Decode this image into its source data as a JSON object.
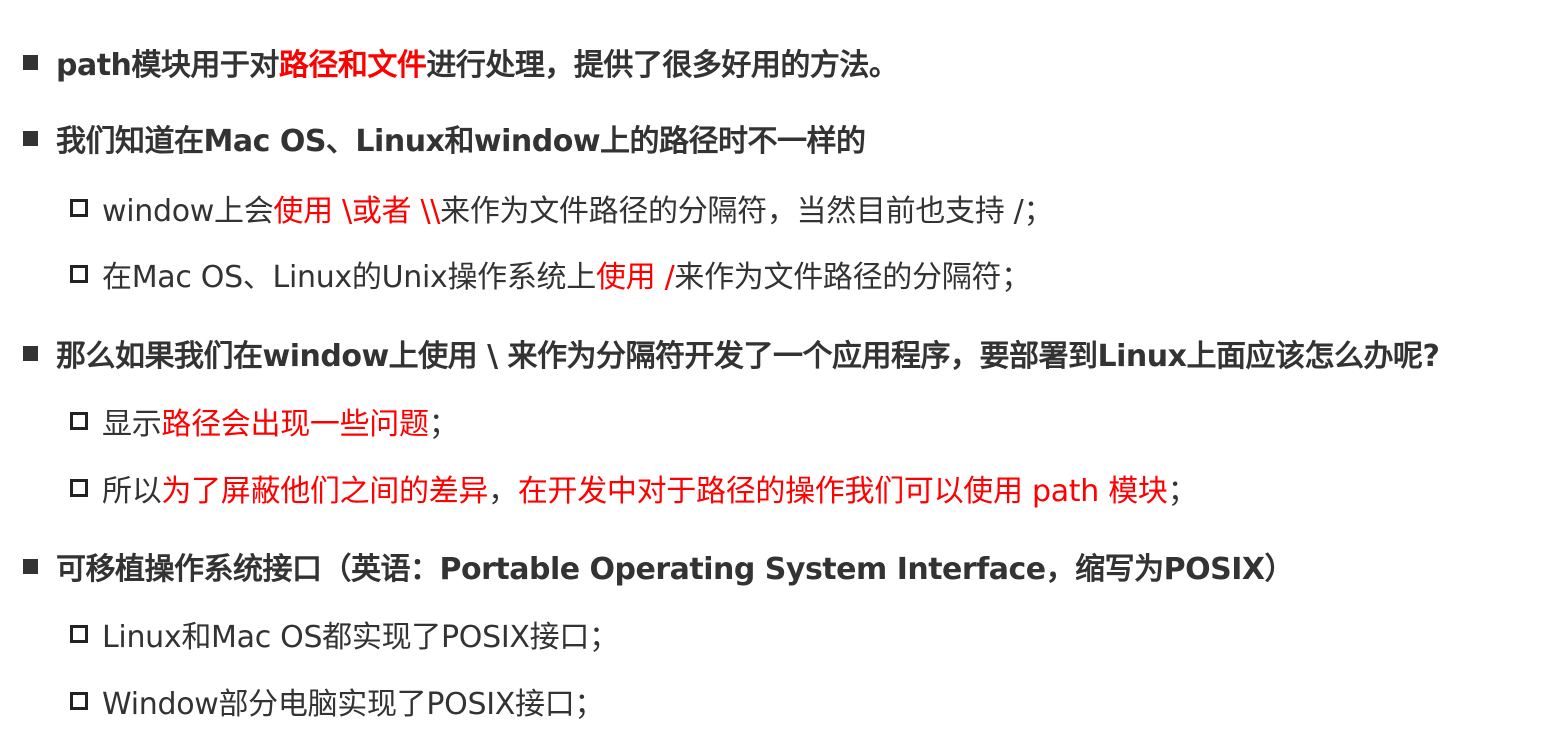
{
  "colors": {
    "text": "#333333",
    "highlight": "#ff0000"
  },
  "items": [
    {
      "level": 1,
      "segments": [
        {
          "text": "path模块用于对",
          "highlight": false
        },
        {
          "text": "路径和文件",
          "highlight": true
        },
        {
          "text": "进行处理，提供了很多好用的方法。",
          "highlight": false
        }
      ]
    },
    {
      "level": 1,
      "segments": [
        {
          "text": "我们知道在Mac OS、Linux和window上的路径时不一样的",
          "highlight": false
        }
      ]
    },
    {
      "level": 2,
      "segments": [
        {
          "text": "window上会",
          "highlight": false
        },
        {
          "text": "使用 \\或者 \\\\",
          "highlight": true
        },
        {
          "text": " 来作为文件路径的分隔符，当然目前也支持 /；",
          "highlight": false
        }
      ]
    },
    {
      "level": 2,
      "segments": [
        {
          "text": "在Mac OS、Linux的Unix操作系统上",
          "highlight": false
        },
        {
          "text": "使用 /",
          "highlight": true
        },
        {
          "text": " 来作为文件路径的分隔符；",
          "highlight": false
        }
      ]
    },
    {
      "level": 1,
      "segments": [
        {
          "text": "那么如果我们在window上使用 \\ 来作为分隔符开发了一个应用程序，要部署到Linux上面应该怎么办呢?",
          "highlight": false
        }
      ]
    },
    {
      "level": 2,
      "segments": [
        {
          "text": "显示",
          "highlight": false
        },
        {
          "text": "路径会出现一些问题",
          "highlight": true
        },
        {
          "text": "；",
          "highlight": false
        }
      ]
    },
    {
      "level": 2,
      "segments": [
        {
          "text": "所以",
          "highlight": false
        },
        {
          "text": "为了屏蔽他们之间的差异",
          "highlight": true
        },
        {
          "text": "，",
          "highlight": false
        },
        {
          "text": "在开发中对于路径的操作我们可以使用 path 模块",
          "highlight": true
        },
        {
          "text": "；",
          "highlight": false
        }
      ]
    },
    {
      "level": 1,
      "segments": [
        {
          "text": "可移植操作系统接口（英语：Portable Operating System Interface，缩写为POSIX）",
          "highlight": false
        }
      ]
    },
    {
      "level": 2,
      "segments": [
        {
          "text": "Linux和Mac OS都实现了POSIX接口；",
          "highlight": false
        }
      ]
    },
    {
      "level": 2,
      "segments": [
        {
          "text": "Window部分电脑实现了POSIX接口；",
          "highlight": false
        }
      ]
    }
  ]
}
